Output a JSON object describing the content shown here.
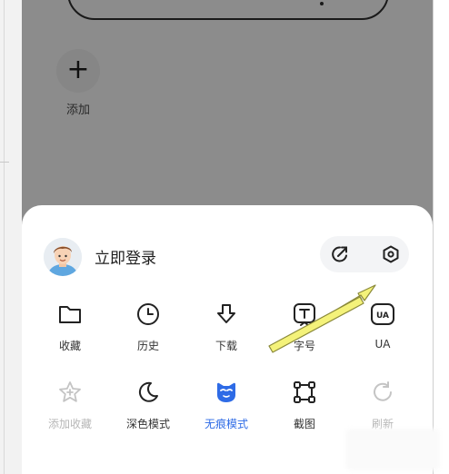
{
  "background": {
    "add_button": {
      "icon": "plus-icon",
      "label": "添加"
    }
  },
  "menu": {
    "login_text": "立即登录",
    "header_actions": [
      {
        "name": "share-icon"
      },
      {
        "name": "settings-icon"
      }
    ],
    "row1": [
      {
        "icon": "folder-icon",
        "label": "收藏"
      },
      {
        "icon": "clock-icon",
        "label": "历史"
      },
      {
        "icon": "download-icon",
        "label": "下载"
      },
      {
        "icon": "font-size-icon",
        "label": "字号"
      },
      {
        "icon": "ua-icon",
        "label": "UA"
      }
    ],
    "row2": [
      {
        "icon": "star-plus-icon",
        "label": "添加收藏",
        "state": "disabled"
      },
      {
        "icon": "moon-icon",
        "label": "深色模式"
      },
      {
        "icon": "incognito-icon",
        "label": "无痕模式",
        "state": "active"
      },
      {
        "icon": "screenshot-icon",
        "label": "截图"
      },
      {
        "icon": "refresh-icon",
        "label": "刷新",
        "state": "disabled"
      }
    ]
  },
  "colors": {
    "accent": "#2e6be6",
    "dim_overlay": "#8c8c8c",
    "annotation_arrow": "#f4f27a"
  }
}
